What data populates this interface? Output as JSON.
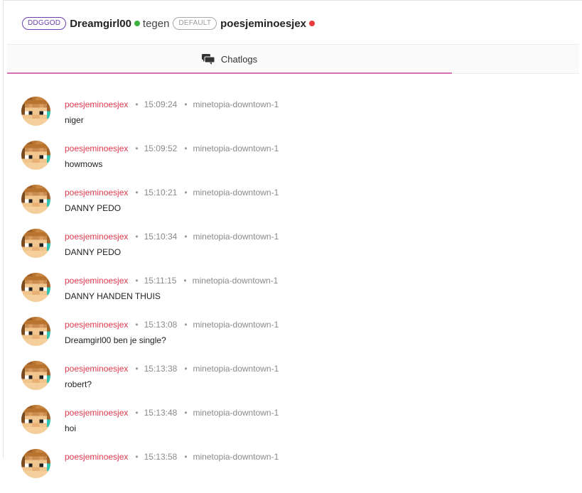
{
  "header": {
    "player1": {
      "rank_badge": "DDGGOD",
      "name": "Dreamgirl00",
      "status_color": "#3cb043"
    },
    "versus_label": "tegen",
    "player2": {
      "rank_badge": "DEFAULT",
      "name": "poesjeminoesjex",
      "status_color": "#ec3b3b"
    }
  },
  "tabs": [
    {
      "label": "Chatlogs",
      "icon": "chat-bubbles-icon",
      "active": true
    }
  ],
  "colors": {
    "accent_underline": "#d86fb1",
    "username": "#e03a4e"
  },
  "separator": "•",
  "messages": [
    {
      "user": "poesjeminoesjex",
      "time": "15:09:24",
      "server": "minetopia-downtown-1",
      "text": "niger"
    },
    {
      "user": "poesjeminoesjex",
      "time": "15:09:52",
      "server": "minetopia-downtown-1",
      "text": "howmows"
    },
    {
      "user": "poesjeminoesjex",
      "time": "15:10:21",
      "server": "minetopia-downtown-1",
      "text": "DANNY PEDO"
    },
    {
      "user": "poesjeminoesjex",
      "time": "15:10:34",
      "server": "minetopia-downtown-1",
      "text": "DANNY PEDO"
    },
    {
      "user": "poesjeminoesjex",
      "time": "15:11:15",
      "server": "minetopia-downtown-1",
      "text": "DANNY HANDEN THUIS"
    },
    {
      "user": "poesjeminoesjex",
      "time": "15:13:08",
      "server": "minetopia-downtown-1",
      "text": "Dreamgirl00 ben je single?"
    },
    {
      "user": "poesjeminoesjex",
      "time": "15:13:38",
      "server": "minetopia-downtown-1",
      "text": "robert?"
    },
    {
      "user": "poesjeminoesjex",
      "time": "15:13:48",
      "server": "minetopia-downtown-1",
      "text": "hoi"
    },
    {
      "user": "poesjeminoesjex",
      "time": "15:13:58",
      "server": "minetopia-downtown-1",
      "text": ""
    }
  ]
}
